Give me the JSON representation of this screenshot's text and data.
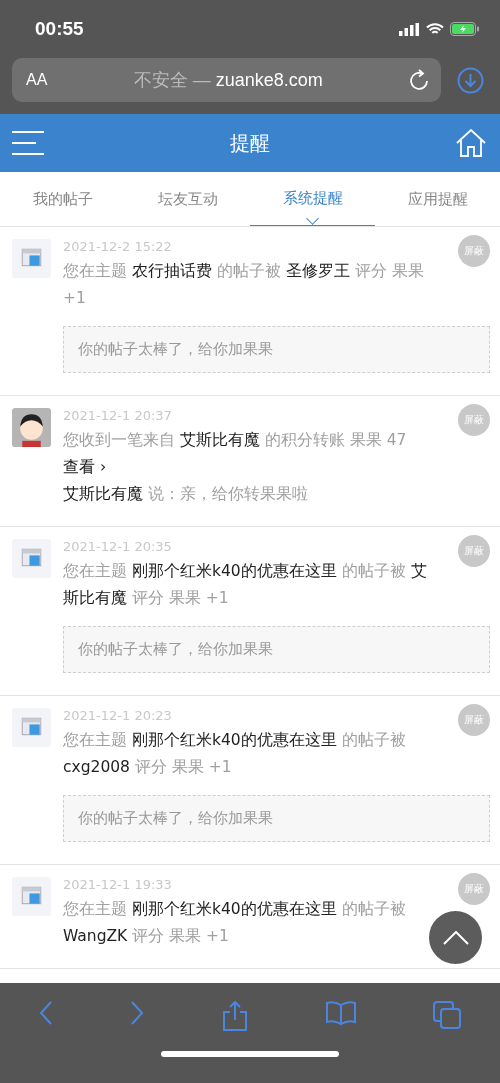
{
  "status_bar": {
    "time": "00:55"
  },
  "address_bar": {
    "text_size_button": "AA",
    "security": "不安全 — ",
    "domain": "zuanke8.com"
  },
  "header": {
    "title": "提醒"
  },
  "tabs": [
    {
      "label": "我的帖子",
      "selected": false
    },
    {
      "label": "坛友互动",
      "selected": false
    },
    {
      "label": "系统提醒",
      "selected": true
    },
    {
      "label": "应用提醒",
      "selected": false
    }
  ],
  "notices": [
    {
      "kind": "system",
      "time": "2021-12-2 15:22",
      "message": "您在主题 **农行抽话费** 的帖子被 **圣修罗王** 评分 果果 +1",
      "quote": "你的帖子太棒了，给你加果果",
      "hide_button": "屏蔽"
    },
    {
      "kind": "user",
      "time": "2021-12-1 20:37",
      "message": "您收到一笔来自 **艾斯比有魔** 的积分转账 果果 47 　**查看 ›**",
      "note": "**艾斯比有魔** 说：亲，给你转果果啦",
      "hide_button": "屏蔽"
    },
    {
      "kind": "system",
      "time": "2021-12-1 20:35",
      "message": "您在主题 **刚那个红米k40的优惠在这里** 的帖子被 **艾斯比有魔** 评分 果果 +1",
      "quote": "你的帖子太棒了，给你加果果",
      "hide_button": "屏蔽"
    },
    {
      "kind": "system",
      "time": "2021-12-1 20:23",
      "message": "您在主题 **刚那个红米k40的优惠在这里** 的帖子被 **cxg2008** 评分 果果 +1",
      "quote": "你的帖子太棒了，给你加果果",
      "hide_button": "屏蔽"
    },
    {
      "kind": "system",
      "time": "2021-12-1 19:33",
      "message": "您在主题 **刚那个红米k40的优惠在这里** 的帖子被 **WangZK** 评分 果果 +1",
      "hide_button": "屏蔽"
    }
  ]
}
